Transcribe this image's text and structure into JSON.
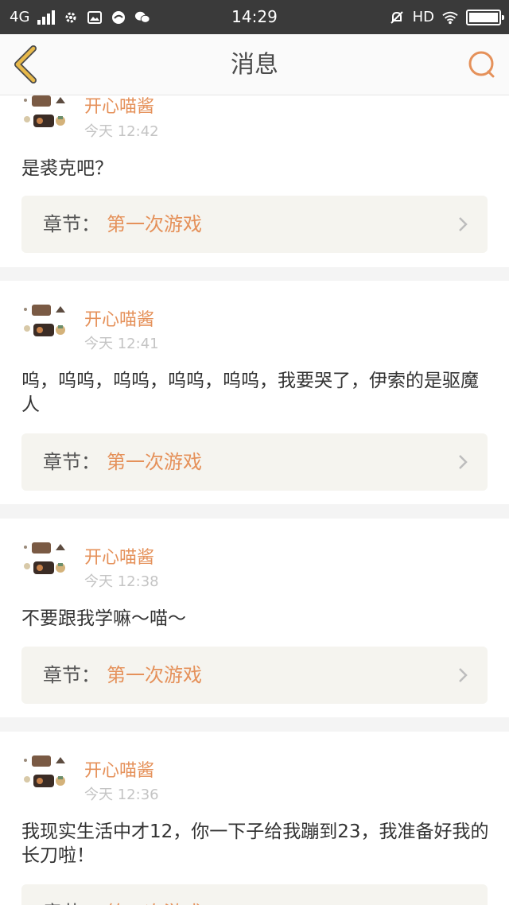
{
  "status": {
    "network": "4G",
    "time": "14:29",
    "hd": "HD"
  },
  "header": {
    "title": "消息"
  },
  "messages": [
    {
      "name": "开心喵酱",
      "time": "今天 12:42",
      "text": "是裘克吧？",
      "chapter_label": "章节：",
      "chapter_value": "第一次游戏"
    },
    {
      "name": "开心喵酱",
      "time": "今天 12:41",
      "text": "呜，呜呜，呜呜，呜呜，呜呜，我要哭了，伊索的是驱魔人",
      "chapter_label": "章节：",
      "chapter_value": "第一次游戏"
    },
    {
      "name": "开心喵酱",
      "time": "今天 12:38",
      "text": "不要跟我学嘛～喵～",
      "chapter_label": "章节：",
      "chapter_value": "第一次游戏"
    },
    {
      "name": "开心喵酱",
      "time": "今天 12:36",
      "text": "我现实生活中才12，你一下子给我蹦到23，我准备好我的长刀啦！",
      "chapter_label": "章节：",
      "chapter_value": "第一次游戏"
    }
  ],
  "colors": {
    "accent": "#e5915a",
    "back_arrow": "#e8b94a",
    "status_bar": "#3a3a3a"
  }
}
